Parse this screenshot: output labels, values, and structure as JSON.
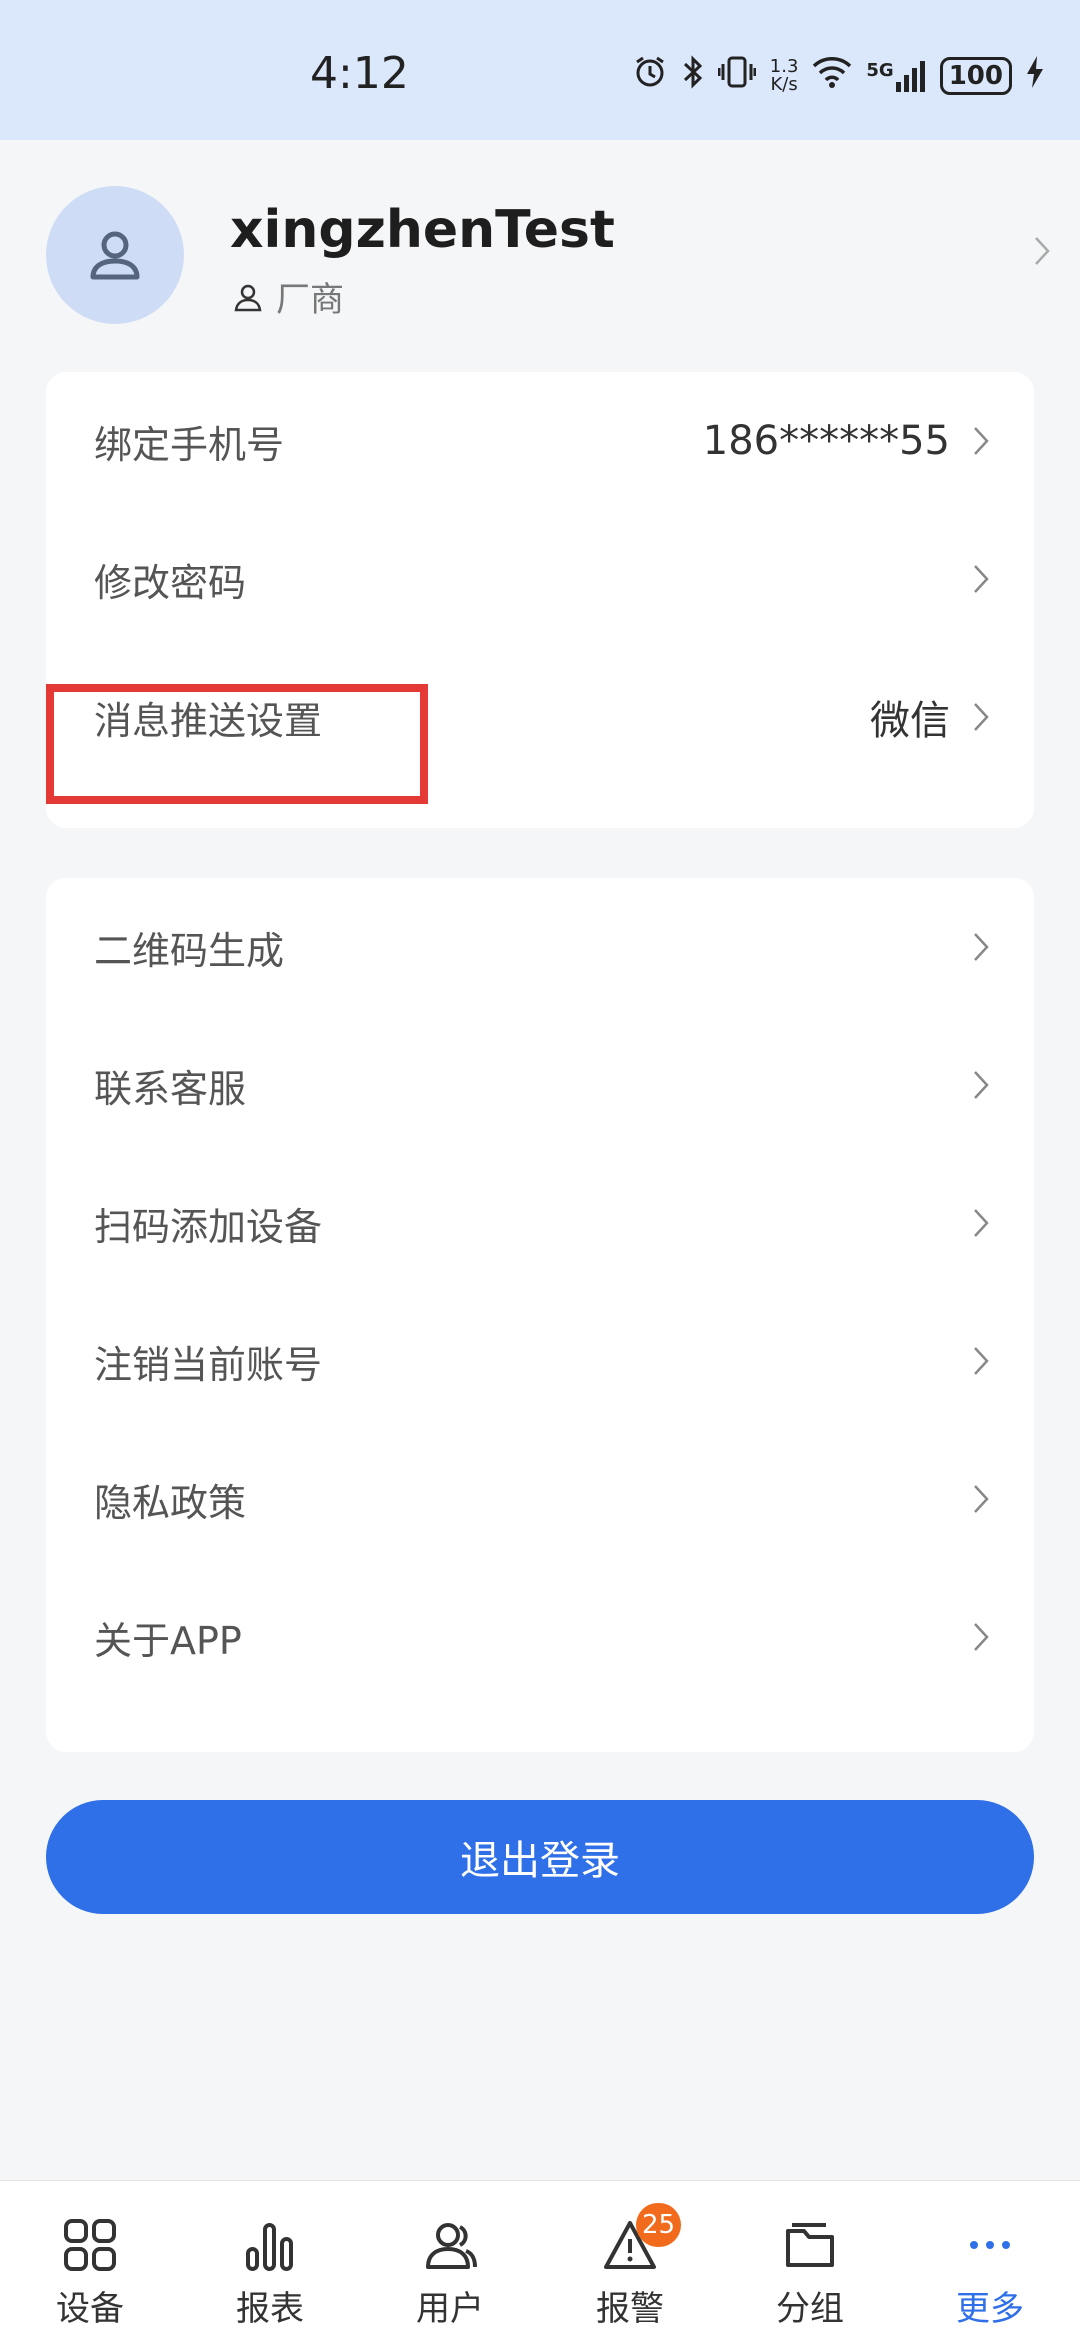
{
  "status_bar": {
    "time": "4:12",
    "net_speed_value": "1.3",
    "net_speed_unit": "K/s",
    "network_type": "5G",
    "battery": "100",
    "icons": [
      "alarm-icon",
      "bluetooth-icon",
      "vibrate-icon",
      "wifi-icon",
      "signal-icon",
      "battery-icon",
      "charging-icon"
    ]
  },
  "profile": {
    "username": "xingzhenTest",
    "role": "厂商",
    "avatar_icon": "user-icon"
  },
  "account_settings": [
    {
      "label": "绑定手机号",
      "value": "186******55"
    },
    {
      "label": "修改密码",
      "value": ""
    },
    {
      "label": "消息推送设置",
      "value": "微信"
    }
  ],
  "general_settings": [
    {
      "label": "二维码生成"
    },
    {
      "label": "联系客服"
    },
    {
      "label": "扫码添加设备"
    },
    {
      "label": "注销当前账号"
    },
    {
      "label": "隐私政策"
    },
    {
      "label": "关于APP"
    }
  ],
  "logout_label": "退出登录",
  "tabs": [
    {
      "label": "设备",
      "icon": "grid-icon"
    },
    {
      "label": "报表",
      "icon": "bar-chart-icon"
    },
    {
      "label": "用户",
      "icon": "users-icon"
    },
    {
      "label": "报警",
      "icon": "warning-icon",
      "badge": "25"
    },
    {
      "label": "分组",
      "icon": "folder-icon"
    },
    {
      "label": "更多",
      "icon": "more-icon"
    }
  ],
  "colors": {
    "accent": "#2f6fe8",
    "badge": "#f26a1b",
    "highlight": "#e53935",
    "status_bar_bg": "#dbe7fb"
  }
}
